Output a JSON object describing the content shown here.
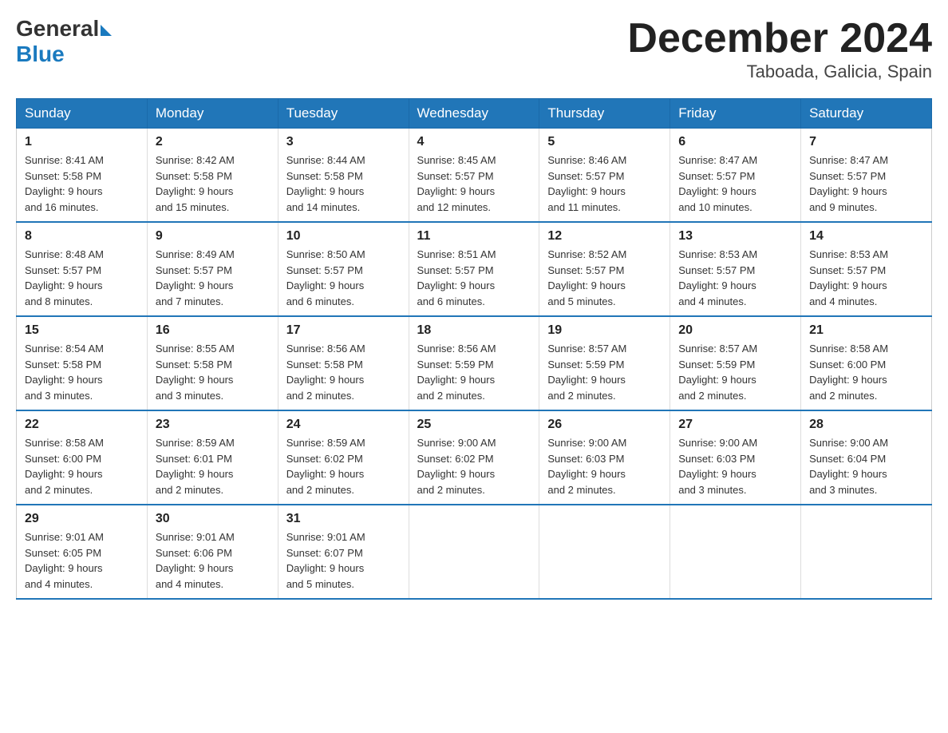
{
  "logo": {
    "general": "General",
    "blue": "Blue",
    "arrow": "▶"
  },
  "title": "December 2024",
  "subtitle": "Taboada, Galicia, Spain",
  "days_of_week": [
    "Sunday",
    "Monday",
    "Tuesday",
    "Wednesday",
    "Thursday",
    "Friday",
    "Saturday"
  ],
  "weeks": [
    [
      {
        "day": "1",
        "sunrise": "8:41 AM",
        "sunset": "5:58 PM",
        "daylight": "9 hours and 16 minutes."
      },
      {
        "day": "2",
        "sunrise": "8:42 AM",
        "sunset": "5:58 PM",
        "daylight": "9 hours and 15 minutes."
      },
      {
        "day": "3",
        "sunrise": "8:44 AM",
        "sunset": "5:58 PM",
        "daylight": "9 hours and 14 minutes."
      },
      {
        "day": "4",
        "sunrise": "8:45 AM",
        "sunset": "5:57 PM",
        "daylight": "9 hours and 12 minutes."
      },
      {
        "day": "5",
        "sunrise": "8:46 AM",
        "sunset": "5:57 PM",
        "daylight": "9 hours and 11 minutes."
      },
      {
        "day": "6",
        "sunrise": "8:47 AM",
        "sunset": "5:57 PM",
        "daylight": "9 hours and 10 minutes."
      },
      {
        "day": "7",
        "sunrise": "8:47 AM",
        "sunset": "5:57 PM",
        "daylight": "9 hours and 9 minutes."
      }
    ],
    [
      {
        "day": "8",
        "sunrise": "8:48 AM",
        "sunset": "5:57 PM",
        "daylight": "9 hours and 8 minutes."
      },
      {
        "day": "9",
        "sunrise": "8:49 AM",
        "sunset": "5:57 PM",
        "daylight": "9 hours and 7 minutes."
      },
      {
        "day": "10",
        "sunrise": "8:50 AM",
        "sunset": "5:57 PM",
        "daylight": "9 hours and 6 minutes."
      },
      {
        "day": "11",
        "sunrise": "8:51 AM",
        "sunset": "5:57 PM",
        "daylight": "9 hours and 6 minutes."
      },
      {
        "day": "12",
        "sunrise": "8:52 AM",
        "sunset": "5:57 PM",
        "daylight": "9 hours and 5 minutes."
      },
      {
        "day": "13",
        "sunrise": "8:53 AM",
        "sunset": "5:57 PM",
        "daylight": "9 hours and 4 minutes."
      },
      {
        "day": "14",
        "sunrise": "8:53 AM",
        "sunset": "5:57 PM",
        "daylight": "9 hours and 4 minutes."
      }
    ],
    [
      {
        "day": "15",
        "sunrise": "8:54 AM",
        "sunset": "5:58 PM",
        "daylight": "9 hours and 3 minutes."
      },
      {
        "day": "16",
        "sunrise": "8:55 AM",
        "sunset": "5:58 PM",
        "daylight": "9 hours and 3 minutes."
      },
      {
        "day": "17",
        "sunrise": "8:56 AM",
        "sunset": "5:58 PM",
        "daylight": "9 hours and 2 minutes."
      },
      {
        "day": "18",
        "sunrise": "8:56 AM",
        "sunset": "5:59 PM",
        "daylight": "9 hours and 2 minutes."
      },
      {
        "day": "19",
        "sunrise": "8:57 AM",
        "sunset": "5:59 PM",
        "daylight": "9 hours and 2 minutes."
      },
      {
        "day": "20",
        "sunrise": "8:57 AM",
        "sunset": "5:59 PM",
        "daylight": "9 hours and 2 minutes."
      },
      {
        "day": "21",
        "sunrise": "8:58 AM",
        "sunset": "6:00 PM",
        "daylight": "9 hours and 2 minutes."
      }
    ],
    [
      {
        "day": "22",
        "sunrise": "8:58 AM",
        "sunset": "6:00 PM",
        "daylight": "9 hours and 2 minutes."
      },
      {
        "day": "23",
        "sunrise": "8:59 AM",
        "sunset": "6:01 PM",
        "daylight": "9 hours and 2 minutes."
      },
      {
        "day": "24",
        "sunrise": "8:59 AM",
        "sunset": "6:02 PM",
        "daylight": "9 hours and 2 minutes."
      },
      {
        "day": "25",
        "sunrise": "9:00 AM",
        "sunset": "6:02 PM",
        "daylight": "9 hours and 2 minutes."
      },
      {
        "day": "26",
        "sunrise": "9:00 AM",
        "sunset": "6:03 PM",
        "daylight": "9 hours and 2 minutes."
      },
      {
        "day": "27",
        "sunrise": "9:00 AM",
        "sunset": "6:03 PM",
        "daylight": "9 hours and 3 minutes."
      },
      {
        "day": "28",
        "sunrise": "9:00 AM",
        "sunset": "6:04 PM",
        "daylight": "9 hours and 3 minutes."
      }
    ],
    [
      {
        "day": "29",
        "sunrise": "9:01 AM",
        "sunset": "6:05 PM",
        "daylight": "9 hours and 4 minutes."
      },
      {
        "day": "30",
        "sunrise": "9:01 AM",
        "sunset": "6:06 PM",
        "daylight": "9 hours and 4 minutes."
      },
      {
        "day": "31",
        "sunrise": "9:01 AM",
        "sunset": "6:07 PM",
        "daylight": "9 hours and 5 minutes."
      },
      null,
      null,
      null,
      null
    ]
  ],
  "labels": {
    "sunrise": "Sunrise:",
    "sunset": "Sunset:",
    "daylight": "Daylight:"
  }
}
